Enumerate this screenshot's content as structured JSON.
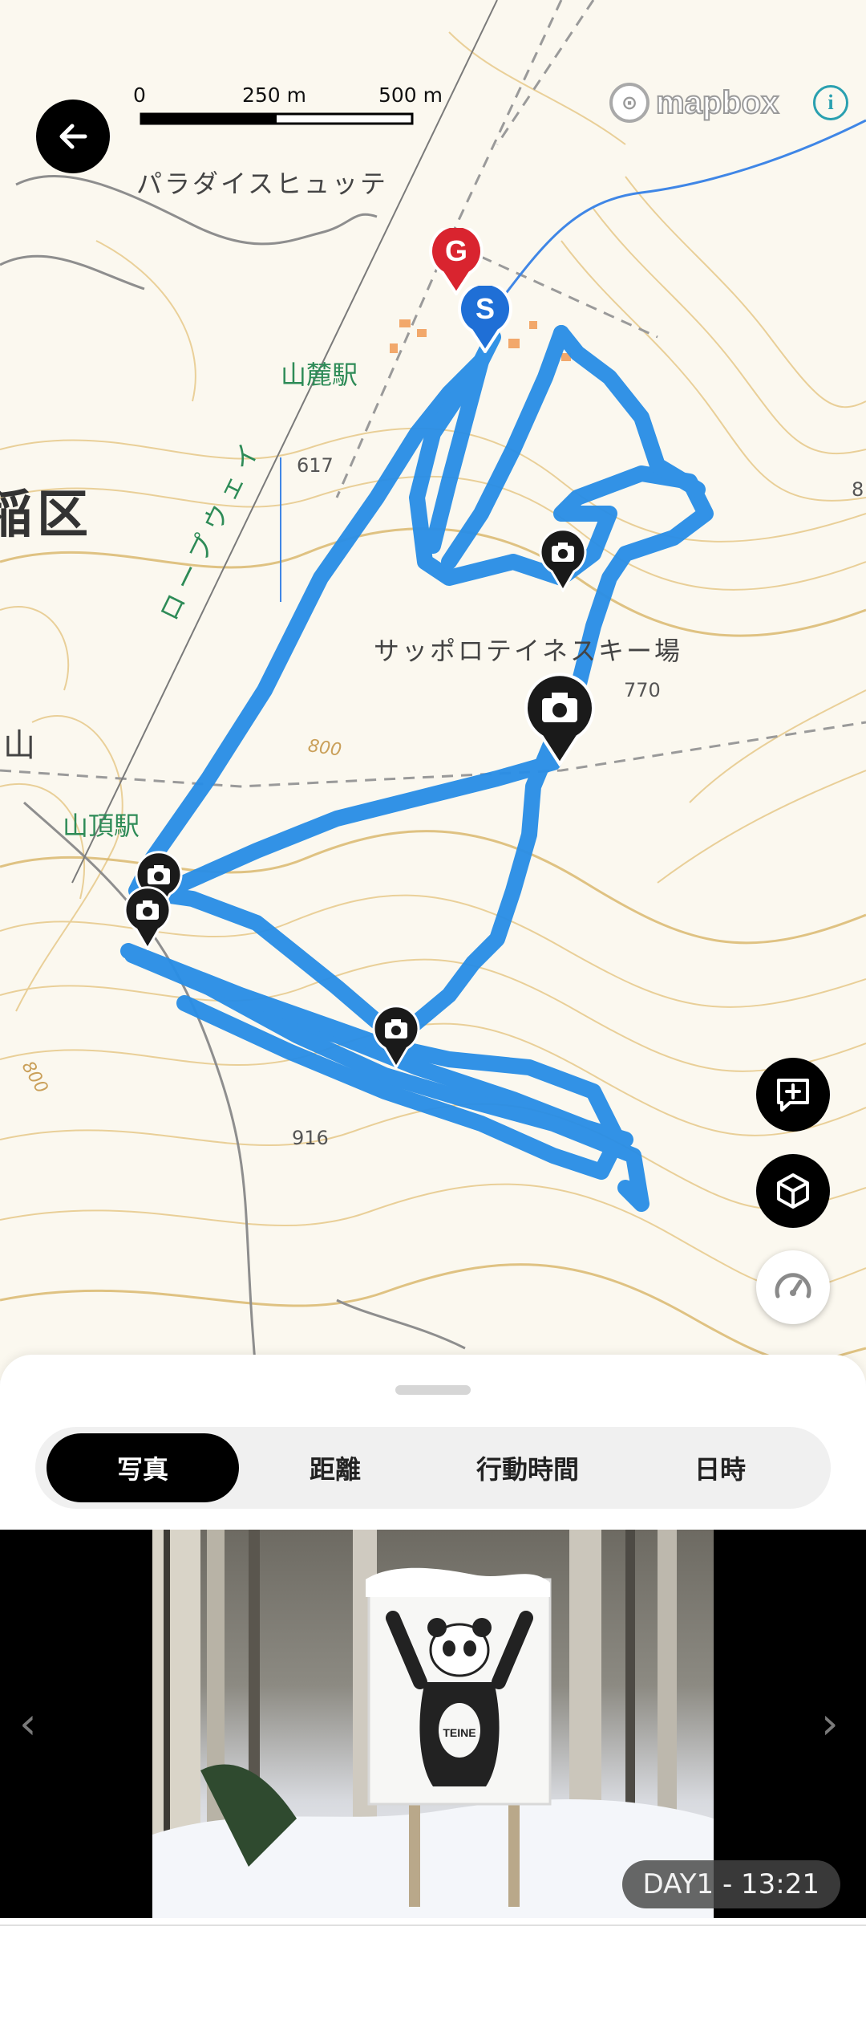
{
  "map": {
    "scale": {
      "label_0": "0",
      "label_250": "250 m",
      "label_500": "500 m"
    },
    "attribution": {
      "logo_text": "mapbox",
      "info_icon": "info-icon"
    },
    "labels": {
      "hut": "パラダイスヒュッテ",
      "base_station": "山麓駅",
      "summit_station": "山頂駅",
      "ski_area": "サッポロテイネスキー場",
      "ropeway": "ロープウェイ",
      "ward_fragment": "稲区",
      "mountain_fragment": "山",
      "elev_617": "617",
      "elev_770": "770",
      "elev_916": "916",
      "contour_800a": "800",
      "contour_800b": "800",
      "edge_8": "8"
    },
    "markers": {
      "goal": "G",
      "start": "S"
    },
    "route_color": "#2a8ee6",
    "goal_color": "#d9242f",
    "start_color": "#1f6fd6"
  },
  "controls": {
    "back_icon": "arrow-left-icon",
    "add_comment_icon": "add-comment-icon",
    "three_d_icon": "cube-icon",
    "speed_icon": "speedometer-icon"
  },
  "sheet": {
    "tabs": [
      {
        "label": "写真",
        "active": true
      },
      {
        "label": "距離",
        "active": false
      },
      {
        "label": "行動時間",
        "active": false
      },
      {
        "label": "日時",
        "active": false
      }
    ],
    "photo": {
      "caption": "DAY1 - 13:21",
      "sign_text": "TEINE",
      "prev_icon": "chevron-left-icon",
      "next_icon": "chevron-right-icon"
    }
  }
}
